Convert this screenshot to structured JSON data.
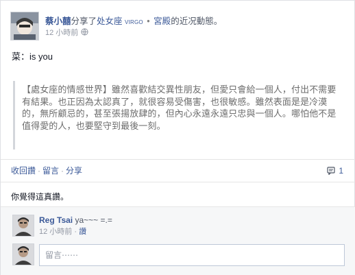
{
  "header": {
    "author": "蔡小囍",
    "action_text": "分享了",
    "page_link": "处女座",
    "page_suffix": "virgo",
    "dot": "•",
    "section_link": "宮殿",
    "tail_text": "的近况動態。",
    "timestamp": "12 小時前"
  },
  "post": {
    "text": "菜：is you",
    "quote": "【處女座的情感世界】雖然喜歡結交異性朋友，但愛只會給一個人，付出不需要有結果。也正因為太認真了，就很容易受傷害，也很敏感。雖然表面是是冷漠的，無所顧忌的，甚至張揚放肆的，但內心永遠永遠只忠與一個人。哪怕他不是值得愛的人，也要堅守到最後一刻。"
  },
  "actions": {
    "unlike": "收回讚",
    "comment": "留言",
    "share": "分享",
    "separator": "·",
    "comment_count": "1"
  },
  "likes": {
    "text": "你覺得這真讚。"
  },
  "comment": {
    "author": "Reg Tsai",
    "text": "ya~~~ =.=",
    "timestamp": "12 小時前",
    "separator": "·",
    "like": "讚"
  },
  "reply": {
    "placeholder": "留言⋯⋯"
  },
  "colors": {
    "link": "#3b5998",
    "meta": "#9197a3",
    "quote_text": "#6d6d6d",
    "quote_bar": "#d3d6db",
    "comments_bg": "#f6f7f8"
  }
}
